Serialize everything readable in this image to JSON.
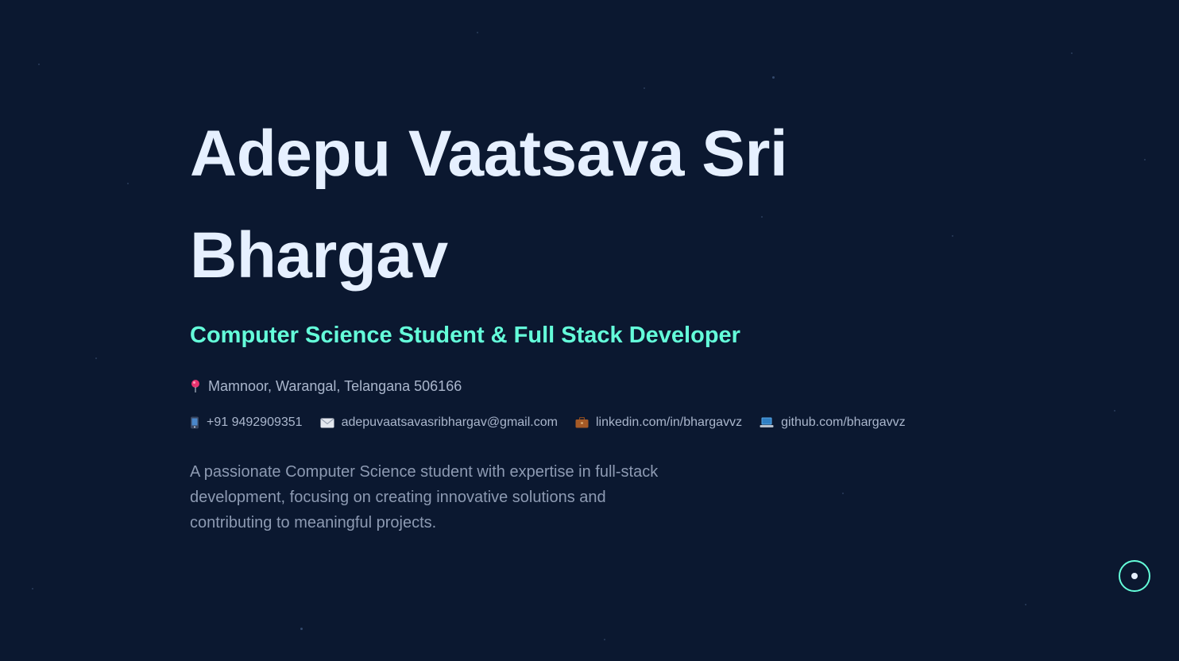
{
  "hero": {
    "name": "Adepu Vaatsava Sri Bhargav",
    "subtitle": "Computer Science Student & Full Stack Developer",
    "location": "Mamnoor, Warangal, Telangana 506166",
    "contacts": {
      "phone": "+91 9492909351",
      "email": "adepuvaatsavasribhargav@gmail.com",
      "linkedin": "linkedin.com/in/bhargavvz",
      "github": "github.com/bhargavvz"
    },
    "bio": "A passionate Computer Science student with expertise in full-stack development, focusing on creating innovative solutions and contributing to meaningful projects."
  },
  "icons": {
    "location": "map-pin-icon",
    "phone": "phone-icon",
    "email": "envelope-icon",
    "linkedin": "briefcase-icon",
    "github": "laptop-icon",
    "scroll": "scroll-indicator-icon"
  },
  "colors": {
    "background": "#0b1830",
    "heading": "#e6f0ff",
    "accent": "#64ffda",
    "text": "#aab6cc",
    "muted": "#8d9ab2"
  }
}
